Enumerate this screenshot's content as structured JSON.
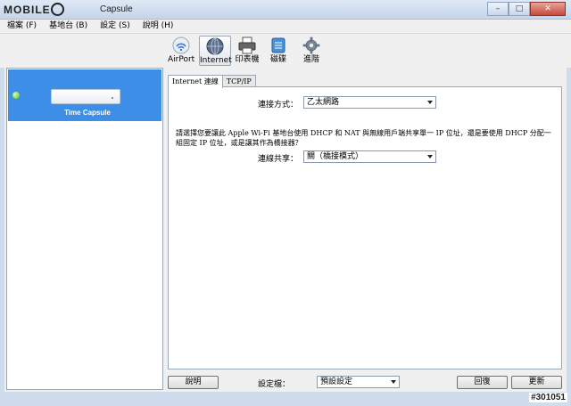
{
  "window": {
    "logo_text": "MOBILE01",
    "title": "Capsule",
    "controls": {
      "minimize": "–",
      "maximize": "□",
      "close": "✕"
    }
  },
  "menu": {
    "items": [
      {
        "label": "檔案 (F)"
      },
      {
        "label": "基地台 (B)"
      },
      {
        "label": "設定 (S)"
      },
      {
        "label": "說明 (H)"
      }
    ]
  },
  "toolbar": {
    "items": [
      {
        "label": "AirPort",
        "icon": "airport-icon"
      },
      {
        "label": "Internet",
        "icon": "internet-globe-icon",
        "active": true
      },
      {
        "label": "印表機",
        "icon": "printer-icon"
      },
      {
        "label": "磁碟",
        "icon": "disk-icon"
      },
      {
        "label": "進階",
        "icon": "gear-icon"
      }
    ]
  },
  "sidebar": {
    "device": {
      "name": "Time Capsule",
      "status_color": "#50c020",
      "selected_color": "#3d8ee6"
    }
  },
  "tabs": [
    {
      "label": "Internet 連線",
      "active": true
    },
    {
      "label": "TCP/IP",
      "active": false
    }
  ],
  "panel": {
    "connection": {
      "label": "連接方式：",
      "value": "乙太網路"
    },
    "description": "請選擇您要讓此 Apple Wi-Fi 基地台使用 DHCP 和 NAT 與無線用戶端共享單一 IP 位址，還是要使用 DHCP 分配一組固定 IP 位址，或是讓其作為橋接器？",
    "sharing": {
      "label": "連線共享：",
      "value": "關（橋接模式）"
    }
  },
  "bottom": {
    "help_button": "說明",
    "profile_label": "設定檔：",
    "profile_value": "預設設定",
    "revert_button": "回復",
    "update_button": "更新"
  },
  "watermark": "#301051"
}
